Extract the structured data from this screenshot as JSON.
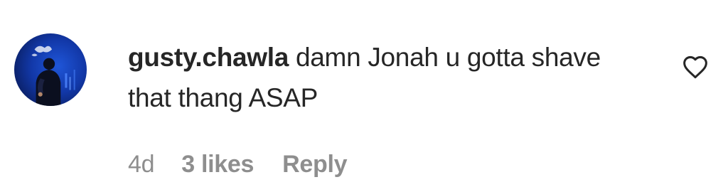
{
  "comment": {
    "username": "gusty.chawla",
    "text": "damn Jonah u gotta shave that thang ASAP",
    "age": "4d",
    "likes": "3 likes",
    "reply_label": "Reply",
    "like_icon": "heart-outline-icon",
    "avatar_icon": "profile-avatar"
  },
  "colors": {
    "text": "#262626",
    "meta": "#8e8e8e",
    "avatar_bg": "#1238a8"
  }
}
